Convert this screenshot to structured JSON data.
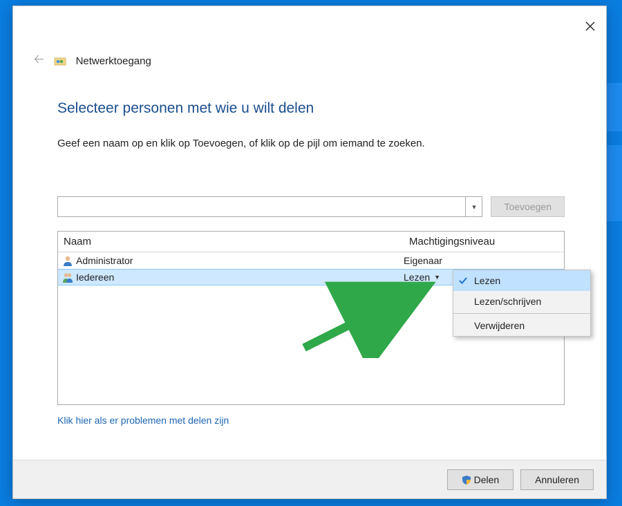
{
  "header": {
    "title": "Netwerktoegang"
  },
  "main": {
    "heading": "Selecteer personen met wie u wilt delen",
    "instruction": "Geef een naam op en klik op Toevoegen, of klik op de pijl om iemand te zoeken.",
    "add_button_label": "Toevoegen",
    "name_input_value": ""
  },
  "table": {
    "col_name": "Naam",
    "col_perm": "Machtigingsniveau",
    "rows": [
      {
        "name": "Administrator",
        "perm": "Eigenaar",
        "selected": false,
        "icon": "user"
      },
      {
        "name": "Iedereen",
        "perm": "Lezen",
        "selected": true,
        "icon": "group"
      }
    ]
  },
  "link": {
    "trouble": "Klik hier als er problemen met delen zijn"
  },
  "permission_menu": {
    "items": [
      {
        "label": "Lezen",
        "selected": true
      },
      {
        "label": "Lezen/schrijven",
        "selected": false
      }
    ],
    "remove_label": "Verwijderen"
  },
  "footer": {
    "share_label": "Delen",
    "cancel_label": "Annuleren"
  }
}
